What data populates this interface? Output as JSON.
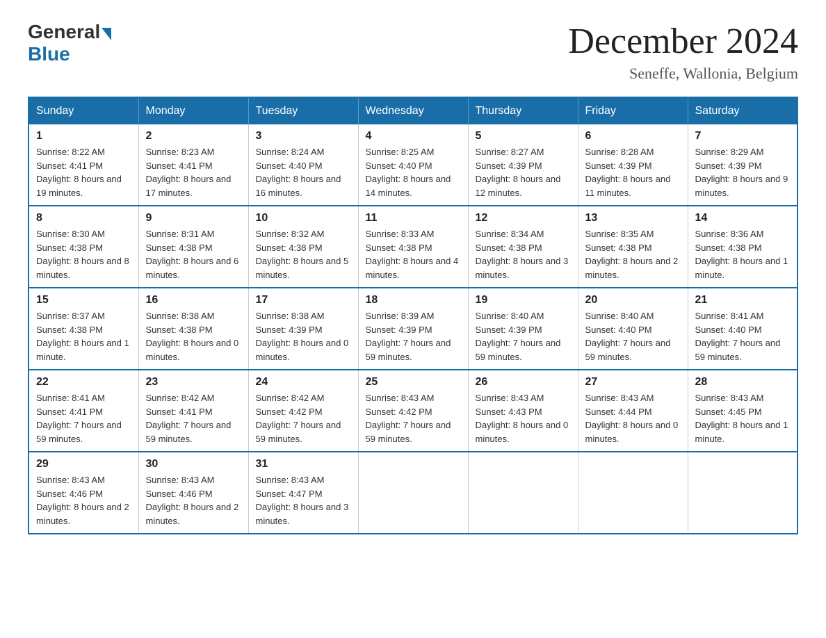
{
  "logo": {
    "text_general": "General",
    "text_blue": "Blue"
  },
  "title": {
    "month_year": "December 2024",
    "location": "Seneffe, Wallonia, Belgium"
  },
  "headers": [
    "Sunday",
    "Monday",
    "Tuesday",
    "Wednesday",
    "Thursday",
    "Friday",
    "Saturday"
  ],
  "weeks": [
    [
      {
        "day": "1",
        "sunrise": "8:22 AM",
        "sunset": "4:41 PM",
        "daylight": "8 hours and 19 minutes."
      },
      {
        "day": "2",
        "sunrise": "8:23 AM",
        "sunset": "4:41 PM",
        "daylight": "8 hours and 17 minutes."
      },
      {
        "day": "3",
        "sunrise": "8:24 AM",
        "sunset": "4:40 PM",
        "daylight": "8 hours and 16 minutes."
      },
      {
        "day": "4",
        "sunrise": "8:25 AM",
        "sunset": "4:40 PM",
        "daylight": "8 hours and 14 minutes."
      },
      {
        "day": "5",
        "sunrise": "8:27 AM",
        "sunset": "4:39 PM",
        "daylight": "8 hours and 12 minutes."
      },
      {
        "day": "6",
        "sunrise": "8:28 AM",
        "sunset": "4:39 PM",
        "daylight": "8 hours and 11 minutes."
      },
      {
        "day": "7",
        "sunrise": "8:29 AM",
        "sunset": "4:39 PM",
        "daylight": "8 hours and 9 minutes."
      }
    ],
    [
      {
        "day": "8",
        "sunrise": "8:30 AM",
        "sunset": "4:38 PM",
        "daylight": "8 hours and 8 minutes."
      },
      {
        "day": "9",
        "sunrise": "8:31 AM",
        "sunset": "4:38 PM",
        "daylight": "8 hours and 6 minutes."
      },
      {
        "day": "10",
        "sunrise": "8:32 AM",
        "sunset": "4:38 PM",
        "daylight": "8 hours and 5 minutes."
      },
      {
        "day": "11",
        "sunrise": "8:33 AM",
        "sunset": "4:38 PM",
        "daylight": "8 hours and 4 minutes."
      },
      {
        "day": "12",
        "sunrise": "8:34 AM",
        "sunset": "4:38 PM",
        "daylight": "8 hours and 3 minutes."
      },
      {
        "day": "13",
        "sunrise": "8:35 AM",
        "sunset": "4:38 PM",
        "daylight": "8 hours and 2 minutes."
      },
      {
        "day": "14",
        "sunrise": "8:36 AM",
        "sunset": "4:38 PM",
        "daylight": "8 hours and 1 minute."
      }
    ],
    [
      {
        "day": "15",
        "sunrise": "8:37 AM",
        "sunset": "4:38 PM",
        "daylight": "8 hours and 1 minute."
      },
      {
        "day": "16",
        "sunrise": "8:38 AM",
        "sunset": "4:38 PM",
        "daylight": "8 hours and 0 minutes."
      },
      {
        "day": "17",
        "sunrise": "8:38 AM",
        "sunset": "4:39 PM",
        "daylight": "8 hours and 0 minutes."
      },
      {
        "day": "18",
        "sunrise": "8:39 AM",
        "sunset": "4:39 PM",
        "daylight": "7 hours and 59 minutes."
      },
      {
        "day": "19",
        "sunrise": "8:40 AM",
        "sunset": "4:39 PM",
        "daylight": "7 hours and 59 minutes."
      },
      {
        "day": "20",
        "sunrise": "8:40 AM",
        "sunset": "4:40 PM",
        "daylight": "7 hours and 59 minutes."
      },
      {
        "day": "21",
        "sunrise": "8:41 AM",
        "sunset": "4:40 PM",
        "daylight": "7 hours and 59 minutes."
      }
    ],
    [
      {
        "day": "22",
        "sunrise": "8:41 AM",
        "sunset": "4:41 PM",
        "daylight": "7 hours and 59 minutes."
      },
      {
        "day": "23",
        "sunrise": "8:42 AM",
        "sunset": "4:41 PM",
        "daylight": "7 hours and 59 minutes."
      },
      {
        "day": "24",
        "sunrise": "8:42 AM",
        "sunset": "4:42 PM",
        "daylight": "7 hours and 59 minutes."
      },
      {
        "day": "25",
        "sunrise": "8:43 AM",
        "sunset": "4:42 PM",
        "daylight": "7 hours and 59 minutes."
      },
      {
        "day": "26",
        "sunrise": "8:43 AM",
        "sunset": "4:43 PM",
        "daylight": "8 hours and 0 minutes."
      },
      {
        "day": "27",
        "sunrise": "8:43 AM",
        "sunset": "4:44 PM",
        "daylight": "8 hours and 0 minutes."
      },
      {
        "day": "28",
        "sunrise": "8:43 AM",
        "sunset": "4:45 PM",
        "daylight": "8 hours and 1 minute."
      }
    ],
    [
      {
        "day": "29",
        "sunrise": "8:43 AM",
        "sunset": "4:46 PM",
        "daylight": "8 hours and 2 minutes."
      },
      {
        "day": "30",
        "sunrise": "8:43 AM",
        "sunset": "4:46 PM",
        "daylight": "8 hours and 2 minutes."
      },
      {
        "day": "31",
        "sunrise": "8:43 AM",
        "sunset": "4:47 PM",
        "daylight": "8 hours and 3 minutes."
      },
      null,
      null,
      null,
      null
    ]
  ]
}
